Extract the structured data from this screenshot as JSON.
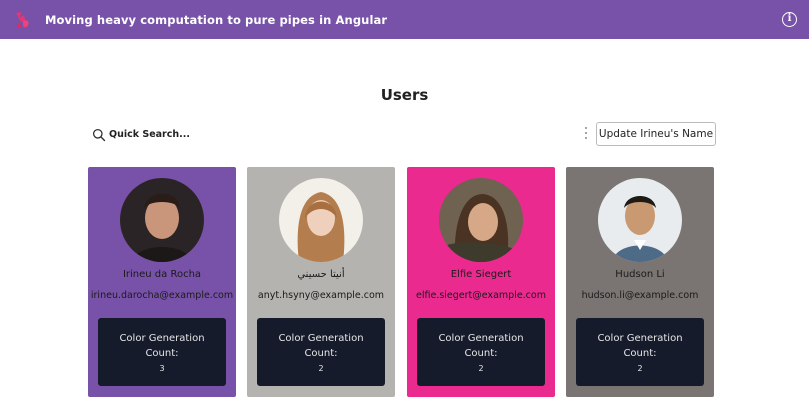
{
  "header": {
    "title": "Moving heavy computation to pure pipes in Angular",
    "info_label": "i",
    "background_color": "#7852a9"
  },
  "main": {
    "heading": "Users",
    "search": {
      "placeholder": "Quick Search...",
      "value": ""
    },
    "update_button_label": "Update Irineu's Name"
  },
  "users": [
    {
      "name": "Irineu da Rocha",
      "email": "irineu.darocha@example.com",
      "card_color": "#7852a9",
      "text_color": "#1a1a1a",
      "count_label": "Color Generation Count:",
      "count_value": "3"
    },
    {
      "name": "أنيتا حسيني",
      "email": "anyt.hsyny@example.com",
      "card_color": "#b5b3b0",
      "text_color": "#1a1a1a",
      "count_label": "Color Generation Count:",
      "count_value": "2"
    },
    {
      "name": "Elfie Siegert",
      "email": "elfie.siegert@example.com",
      "card_color": "#ea2a8f",
      "text_color": "#1a1a1a",
      "count_label": "Color Generation Count:",
      "count_value": "2"
    },
    {
      "name": "Hudson Li",
      "email": "hudson.li@example.com",
      "card_color": "#7a7573",
      "text_color": "#1a1a1a",
      "count_label": "Color Generation Count:",
      "count_value": "2"
    }
  ]
}
